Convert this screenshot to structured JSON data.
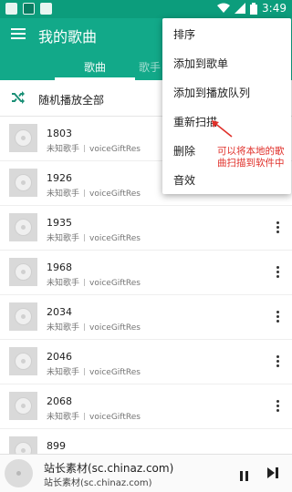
{
  "status_bar": {
    "time": "3:49",
    "icons": [
      "notification-square-icon",
      "image-icon",
      "notification-square-icon",
      "wifi-icon",
      "signal-icon",
      "battery-icon"
    ]
  },
  "toolbar": {
    "title": "我的歌曲",
    "menu_icon": "hamburger-menu-icon"
  },
  "tabs": [
    {
      "label": "歌曲",
      "active": true
    },
    {
      "label": "歌手",
      "active": false
    }
  ],
  "shuffle": {
    "icon": "shuffle-icon",
    "label": "随机播放全部"
  },
  "songs": [
    {
      "title": "1803",
      "artist": "未知歌手",
      "album": "voiceGiftRes"
    },
    {
      "title": "1926",
      "artist": "未知歌手",
      "album": "voiceGiftRes"
    },
    {
      "title": "1935",
      "artist": "未知歌手",
      "album": "voiceGiftRes"
    },
    {
      "title": "1968",
      "artist": "未知歌手",
      "album": "voiceGiftRes"
    },
    {
      "title": "2034",
      "artist": "未知歌手",
      "album": "voiceGiftRes"
    },
    {
      "title": "2046",
      "artist": "未知歌手",
      "album": "voiceGiftRes"
    },
    {
      "title": "2068",
      "artist": "未知歌手",
      "album": "voiceGiftRes"
    },
    {
      "title": "899",
      "artist": "",
      "album": ""
    }
  ],
  "popup_menu": {
    "items": [
      "排序",
      "添加到歌单",
      "添加到播放队列",
      "重新扫描",
      "删除",
      "音效"
    ]
  },
  "annotation": {
    "text": "可以将本地的歌曲扫描到软件中",
    "color": "#e0302a"
  },
  "player": {
    "title": "站长素材(sc.chinaz.com)",
    "artist": "站长素材(sc.chinaz.com)",
    "pause_icon": "pause-icon",
    "next_icon": "skip-next-icon"
  },
  "colors": {
    "primary": "#12a989",
    "status_bar": "#0c9d7c",
    "annotation": "#e0302a"
  }
}
